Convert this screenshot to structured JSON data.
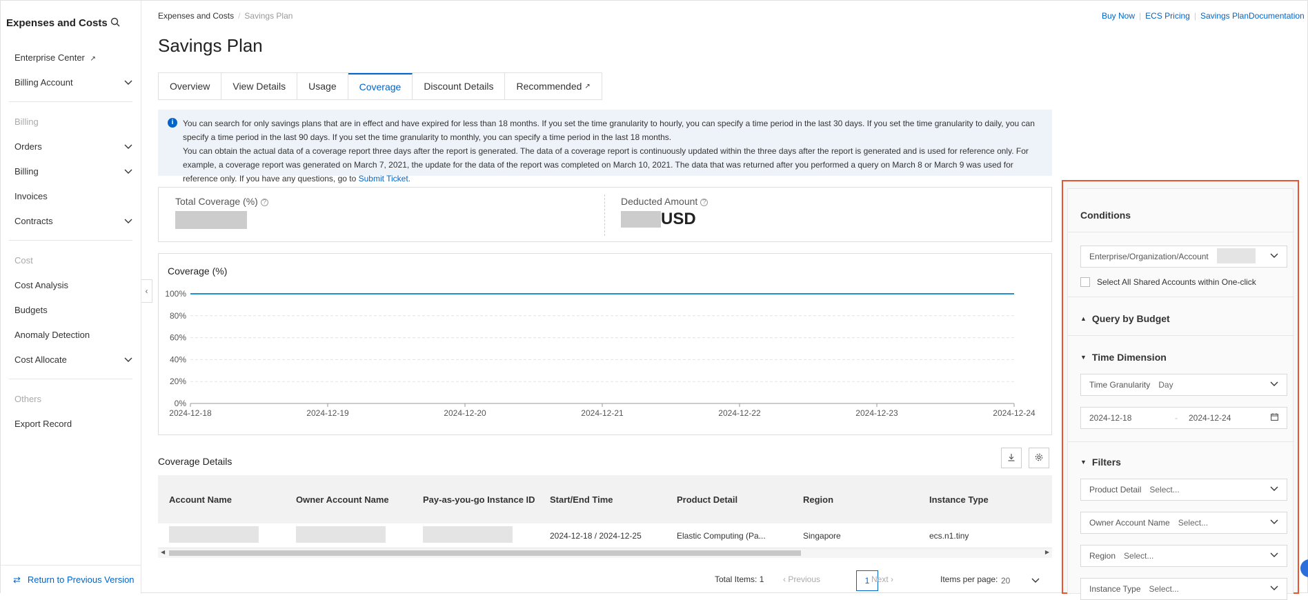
{
  "sidebar": {
    "title": "Expenses and Costs",
    "enterprise_center": "Enterprise Center",
    "billing_account": "Billing Account",
    "section_billing": "Billing",
    "orders": "Orders",
    "billing": "Billing",
    "invoices": "Invoices",
    "contracts": "Contracts",
    "section_cost": "Cost",
    "cost_analysis": "Cost Analysis",
    "budgets": "Budgets",
    "anomaly_detection": "Anomaly Detection",
    "cost_allocate": "Cost Allocate",
    "section_others": "Others",
    "export_record": "Export Record",
    "return_label": "Return to Previous Version"
  },
  "breadcrumb": {
    "parent": "Expenses and Costs",
    "current": "Savings Plan"
  },
  "top_links": {
    "buy_now": "Buy Now",
    "ecs_pricing": "ECS Pricing",
    "docs": "Savings PlanDocumentation"
  },
  "page_title": "Savings Plan",
  "tabs": [
    "Overview",
    "View Details",
    "Usage",
    "Coverage",
    "Discount Details",
    "Recommended"
  ],
  "notice": {
    "line1": "You can search for only savings plans that are in effect and have expired for less than 18 months. If you set the time granularity to hourly, you can specify a time period in the last 30 days. If you set the time granularity to daily, you can specify a time period in the last 90 days. If you set the time granularity to monthly, you can specify a time period in the last 18 months.",
    "line2": "You can obtain the actual data of a coverage report three days after the report is generated. The data of a coverage report is continuously updated within the three days after the report is generated and is used for reference only. For example, a coverage report was generated on March 7, 2021, the update for the data of the report was completed on March 10, 2021. The data that was returned after you performed a query on March 8 or March 9 was used for reference only. If you have any questions, go to",
    "link": "Submit Ticket."
  },
  "stats": {
    "total_coverage_label": "Total Coverage (%)",
    "deducted_amount_label": "Deducted Amount",
    "currency": "USD"
  },
  "chart_data": {
    "type": "line",
    "title": "Coverage (%)",
    "x": [
      "2024-12-18",
      "2024-12-19",
      "2024-12-20",
      "2024-12-21",
      "2024-12-22",
      "2024-12-23",
      "2024-12-24"
    ],
    "series": [
      {
        "values": [
          100,
          100,
          100,
          100,
          100,
          100,
          100
        ]
      }
    ],
    "y_ticks": [
      "0%",
      "20%",
      "40%",
      "60%",
      "80%",
      "100%"
    ],
    "ylim": [
      0,
      100
    ],
    "grid": true,
    "line_color": "#1f8fd6"
  },
  "coverage_details": {
    "title": "Coverage Details",
    "columns": [
      "Account Name",
      "Owner Account Name",
      "Pay-as-you-go Instance ID",
      "Start/End Time",
      "Product Detail",
      "Region",
      "Instance Type"
    ],
    "rows": [
      {
        "start_end": "2024-12-18 / 2024-12-25",
        "product": "Elastic Computing (Pa...",
        "region": "Singapore",
        "instance_type": "ecs.n1.tiny"
      }
    ]
  },
  "pager": {
    "total": "Total Items: 1",
    "previous": "Previous",
    "page": "1",
    "next": "Next",
    "per_page_label": "Items per page:",
    "per_page": "20"
  },
  "conditions": {
    "title": "Conditions",
    "enterprise_label": "Enterprise/Organization/Account",
    "select_all_shared": "Select All Shared Accounts within One-click",
    "query_by_budget": "Query by Budget",
    "time_dimension": "Time Dimension",
    "time_granularity_label": "Time Granularity",
    "time_granularity_value": "Day",
    "date_start": "2024-12-18",
    "date_end": "2024-12-24",
    "filters": "Filters",
    "product_detail_label": "Product Detail",
    "owner_account_label": "Owner Account Name",
    "region_label": "Region",
    "instance_type_label": "Instance Type",
    "select_placeholder": "Select..."
  }
}
